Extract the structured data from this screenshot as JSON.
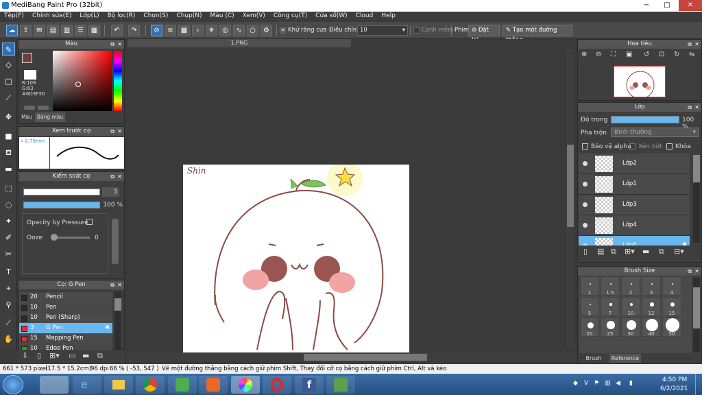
{
  "window": {
    "title": "MediBang Paint Pro (32bit)",
    "min": "−",
    "max": "□",
    "close": "✕"
  },
  "menu": [
    "Tệp(F)",
    "Chỉnh sửa(E)",
    "Lớp(L)",
    "Bộ lọc(R)",
    "Chọn(S)",
    "Chụp(N)",
    "Màu (C)",
    "Xem(V)",
    "Công cụ(T)",
    "Cửa sổ(W)",
    "Cloud",
    "Help"
  ],
  "toolbar": {
    "antialias_label": "Khử răng cưa",
    "adjust_label": "Điều chỉnh",
    "adjust_value": "10",
    "snap_label": "Cạnh mềm",
    "key_label": "Phim",
    "reset_label": "Đặt lại",
    "new_line_label": "Tạo một đường thẳng"
  },
  "color_panel": {
    "title": "Màu",
    "r": "R:109",
    "g": "G:63",
    "hex": "#6D3F3D",
    "current_color": "#6D3F3D",
    "tab1": "Màu",
    "tab2": "Bảng màu"
  },
  "preview_panel": {
    "title": "Xem trước cọ",
    "size": "0.79mm"
  },
  "brush_control": {
    "title": "Kiểm soát cọ",
    "size_value": "3",
    "opacity_value": "100 %",
    "opacity_fill": 1.0,
    "opacity_pressure_label": "Opacity by Pressure",
    "ooze_label": "Ooze",
    "ooze_value": "0"
  },
  "brush_panel": {
    "title": "Cọ: G Pen",
    "items": [
      {
        "size": "20",
        "name": "Pencil",
        "color": "#2a2a2a"
      },
      {
        "size": "10",
        "name": "Pen",
        "color": "#2a2a2a"
      },
      {
        "size": "10",
        "name": "Pen (Sharp)",
        "color": "#2a2a2a"
      },
      {
        "size": "3",
        "name": "G Pen",
        "color": "#e03030"
      },
      {
        "size": "15",
        "name": "Mapping Pen",
        "color": "#e03030"
      },
      {
        "size": "10",
        "name": "Edge Pen",
        "color": "#2fa02f"
      }
    ]
  },
  "document": {
    "tab": "1.PNG",
    "signature": "Shin"
  },
  "navigator": {
    "title": "Hoa tiêu"
  },
  "layer_panel": {
    "title": "Lớp",
    "opacity_label": "Độ trong",
    "opacity_value": "100 %",
    "opacity_fill": 1.0,
    "blend_label": "Pha trộn",
    "blend_value": "Bình thường",
    "protect_alpha": "Bảo vệ alpha",
    "clipping": "Xén bớt",
    "lock": "Khóa",
    "layers": [
      "Lớp2",
      "Lớp1",
      "Lớp3",
      "Lớp4",
      "Lớp5"
    ]
  },
  "brush_size_panel": {
    "title": "Brush Size",
    "sizes": [
      "1",
      "1.5",
      "2",
      "3",
      "4",
      "5",
      "7",
      "10",
      "12",
      "15",
      "20",
      "25",
      "30",
      "40",
      "50"
    ],
    "tab1": "Brush Size",
    "tab2": "Reference"
  },
  "statusbar": {
    "dims": "661 * 573 pixel",
    "cm": "(17.5 * 15.2cm)",
    "dpi": "96 dpi",
    "zoom": "66 %",
    "coords": "( -53, 547 )",
    "hint": "Vẽ một đường thẳng bằng cách giữ phím Shift, Thay đổi cỡ cọ bằng cách giữ phím Ctrl, Alt và kéo"
  },
  "taskbar": {
    "time": "4:50 PM",
    "date": "6/2/2021"
  }
}
